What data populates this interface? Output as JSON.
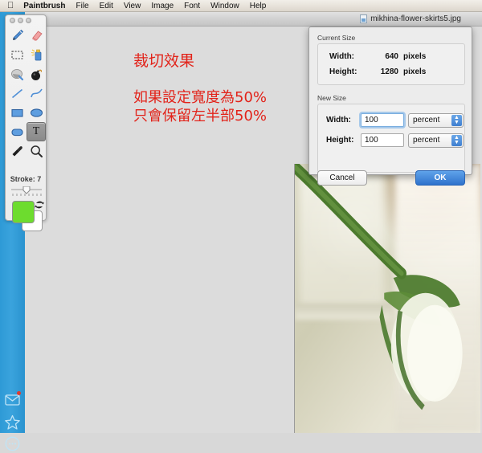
{
  "menubar": {
    "apple_icon": "apple-icon",
    "items": [
      {
        "label": "Paintbrush",
        "bold": true
      },
      {
        "label": "File"
      },
      {
        "label": "Edit"
      },
      {
        "label": "View"
      },
      {
        "label": "Image"
      },
      {
        "label": "Font"
      },
      {
        "label": "Window"
      },
      {
        "label": "Help"
      }
    ]
  },
  "document_window": {
    "title": "mikhina-flower-skirts5.jpg",
    "close_button_color": "#4fbb2e"
  },
  "canvas": {
    "annotations": {
      "title": "裁切效果",
      "line1": "如果設定寬度為50%",
      "line2": "只會保留左半部50%"
    },
    "annotation_color": "#e2231a",
    "background_color": "#dcdcdc"
  },
  "palette": {
    "tools": [
      {
        "name": "pencil-tool",
        "selected": false
      },
      {
        "name": "eraser-tool",
        "selected": false
      },
      {
        "name": "selection-tool",
        "selected": false
      },
      {
        "name": "spray-can-tool",
        "selected": false
      },
      {
        "name": "paint-bucket-tool",
        "selected": false
      },
      {
        "name": "bomb-tool",
        "selected": false
      },
      {
        "name": "line-tool",
        "selected": false
      },
      {
        "name": "curve-tool",
        "selected": false
      },
      {
        "name": "rectangle-tool",
        "selected": false
      },
      {
        "name": "ellipse-tool",
        "selected": false
      },
      {
        "name": "rounded-rectangle-tool",
        "selected": false
      },
      {
        "name": "text-tool",
        "selected": true
      },
      {
        "name": "eyedropper-tool",
        "selected": false
      },
      {
        "name": "magnifier-tool",
        "selected": false
      }
    ],
    "text_tool_glyph": "T",
    "stroke_label": "Stroke: 7",
    "stroke_value": 7,
    "foreground_color": "#6ddc2e",
    "background_color": "#ffffff"
  },
  "dialog": {
    "current_size": {
      "group_label": "Current Size",
      "rows": [
        {
          "label": "Width:",
          "value": "640",
          "unit": "pixels"
        },
        {
          "label": "Height:",
          "value": "1280",
          "unit": "pixels"
        }
      ]
    },
    "new_size": {
      "group_label": "New Size",
      "width_label": "Width:",
      "width_value": "100",
      "width_unit": "percent",
      "height_label": "Height:",
      "height_value": "100",
      "height_unit": "percent"
    },
    "buttons": {
      "cancel": "Cancel",
      "ok": "OK"
    }
  },
  "finder_sidebar": {
    "icons": [
      {
        "name": "mail-icon",
        "has_badge": true
      },
      {
        "name": "star-icon",
        "has_badge": false
      },
      {
        "name": "messages-icon",
        "has_badge": false
      }
    ]
  }
}
